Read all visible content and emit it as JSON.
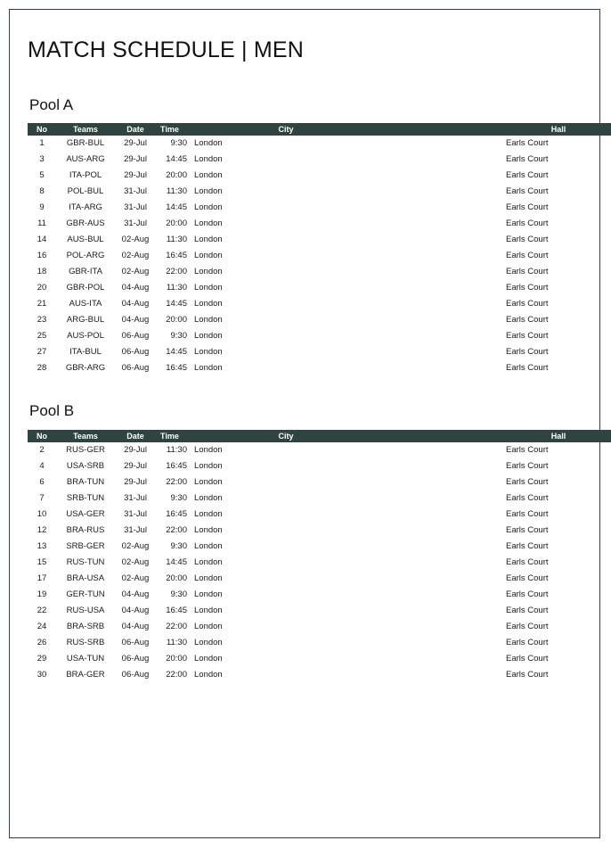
{
  "document": {
    "title": "MATCH SCHEDULE | MEN",
    "watermark_text": " "
  },
  "columns": {
    "no": "No",
    "teams": "Teams",
    "date": "Date",
    "time": "Time",
    "city": "City",
    "hall": "Hall"
  },
  "colors": {
    "header_bar": "#2f4440",
    "header_text": "#ffffff",
    "page_border": "#2f3d3d",
    "body_text": "#1a1a1a",
    "page_background": "#ffffff"
  },
  "pools": [
    {
      "id": "pool-a",
      "heading": "Pool A",
      "rows": [
        {
          "no": "1",
          "teams": "GBR-BUL",
          "date": "29-Jul",
          "time": "9:30",
          "city": "London",
          "hall": "Earls Court"
        },
        {
          "no": "3",
          "teams": "AUS-ARG",
          "date": "29-Jul",
          "time": "14:45",
          "city": "London",
          "hall": "Earls Court"
        },
        {
          "no": "5",
          "teams": "ITA-POL",
          "date": "29-Jul",
          "time": "20:00",
          "city": "London",
          "hall": "Earls Court"
        },
        {
          "no": "8",
          "teams": "POL-BUL",
          "date": "31-Jul",
          "time": "11:30",
          "city": "London",
          "hall": "Earls Court"
        },
        {
          "no": "9",
          "teams": "ITA-ARG",
          "date": "31-Jul",
          "time": "14:45",
          "city": "London",
          "hall": "Earls Court"
        },
        {
          "no": "11",
          "teams": "GBR-AUS",
          "date": "31-Jul",
          "time": "20:00",
          "city": "London",
          "hall": "Earls Court"
        },
        {
          "no": "14",
          "teams": "AUS-BUL",
          "date": "02-Aug",
          "time": "11:30",
          "city": "London",
          "hall": "Earls Court"
        },
        {
          "no": "16",
          "teams": "POL-ARG",
          "date": "02-Aug",
          "time": "16:45",
          "city": "London",
          "hall": "Earls Court"
        },
        {
          "no": "18",
          "teams": "GBR-ITA",
          "date": "02-Aug",
          "time": "22:00",
          "city": "London",
          "hall": "Earls Court"
        },
        {
          "no": "20",
          "teams": "GBR-POL",
          "date": "04-Aug",
          "time": "11:30",
          "city": "London",
          "hall": "Earls Court"
        },
        {
          "no": "21",
          "teams": "AUS-ITA",
          "date": "04-Aug",
          "time": "14:45",
          "city": "London",
          "hall": "Earls Court"
        },
        {
          "no": "23",
          "teams": "ARG-BUL",
          "date": "04-Aug",
          "time": "20:00",
          "city": "London",
          "hall": "Earls Court"
        },
        {
          "no": "25",
          "teams": "AUS-POL",
          "date": "06-Aug",
          "time": "9:30",
          "city": "London",
          "hall": "Earls Court"
        },
        {
          "no": "27",
          "teams": "ITA-BUL",
          "date": "06-Aug",
          "time": "14:45",
          "city": "London",
          "hall": "Earls Court"
        },
        {
          "no": "28",
          "teams": "GBR-ARG",
          "date": "06-Aug",
          "time": "16:45",
          "city": "London",
          "hall": "Earls Court"
        }
      ]
    },
    {
      "id": "pool-b",
      "heading": "Pool B",
      "rows": [
        {
          "no": "2",
          "teams": "RUS-GER",
          "date": "29-Jul",
          "time": "11:30",
          "city": "London",
          "hall": "Earls Court"
        },
        {
          "no": "4",
          "teams": "USA-SRB",
          "date": "29-Jul",
          "time": "16:45",
          "city": "London",
          "hall": "Earls Court"
        },
        {
          "no": "6",
          "teams": "BRA-TUN",
          "date": "29-Jul",
          "time": "22:00",
          "city": "London",
          "hall": "Earls Court"
        },
        {
          "no": "7",
          "teams": "SRB-TUN",
          "date": "31-Jul",
          "time": "9:30",
          "city": "London",
          "hall": "Earls Court"
        },
        {
          "no": "10",
          "teams": "USA-GER",
          "date": "31-Jul",
          "time": "16:45",
          "city": "London",
          "hall": "Earls Court"
        },
        {
          "no": "12",
          "teams": "BRA-RUS",
          "date": "31-Jul",
          "time": "22:00",
          "city": "London",
          "hall": "Earls Court"
        },
        {
          "no": "13",
          "teams": "SRB-GER",
          "date": "02-Aug",
          "time": "9:30",
          "city": "London",
          "hall": "Earls Court"
        },
        {
          "no": "15",
          "teams": "RUS-TUN",
          "date": "02-Aug",
          "time": "14:45",
          "city": "London",
          "hall": "Earls Court"
        },
        {
          "no": "17",
          "teams": "BRA-USA",
          "date": "02-Aug",
          "time": "20:00",
          "city": "London",
          "hall": "Earls Court"
        },
        {
          "no": "19",
          "teams": "GER-TUN",
          "date": "04-Aug",
          "time": "9:30",
          "city": "London",
          "hall": "Earls Court"
        },
        {
          "no": "22",
          "teams": "RUS-USA",
          "date": "04-Aug",
          "time": "16:45",
          "city": "London",
          "hall": "Earls Court"
        },
        {
          "no": "24",
          "teams": "BRA-SRB",
          "date": "04-Aug",
          "time": "22:00",
          "city": "London",
          "hall": "Earls Court"
        },
        {
          "no": "26",
          "teams": "RUS-SRB",
          "date": "06-Aug",
          "time": "11:30",
          "city": "London",
          "hall": "Earls Court"
        },
        {
          "no": "29",
          "teams": "USA-TUN",
          "date": "06-Aug",
          "time": "20:00",
          "city": "London",
          "hall": "Earls Court"
        },
        {
          "no": "30",
          "teams": "BRA-GER",
          "date": "06-Aug",
          "time": "22:00",
          "city": "London",
          "hall": "Earls Court"
        }
      ]
    }
  ]
}
